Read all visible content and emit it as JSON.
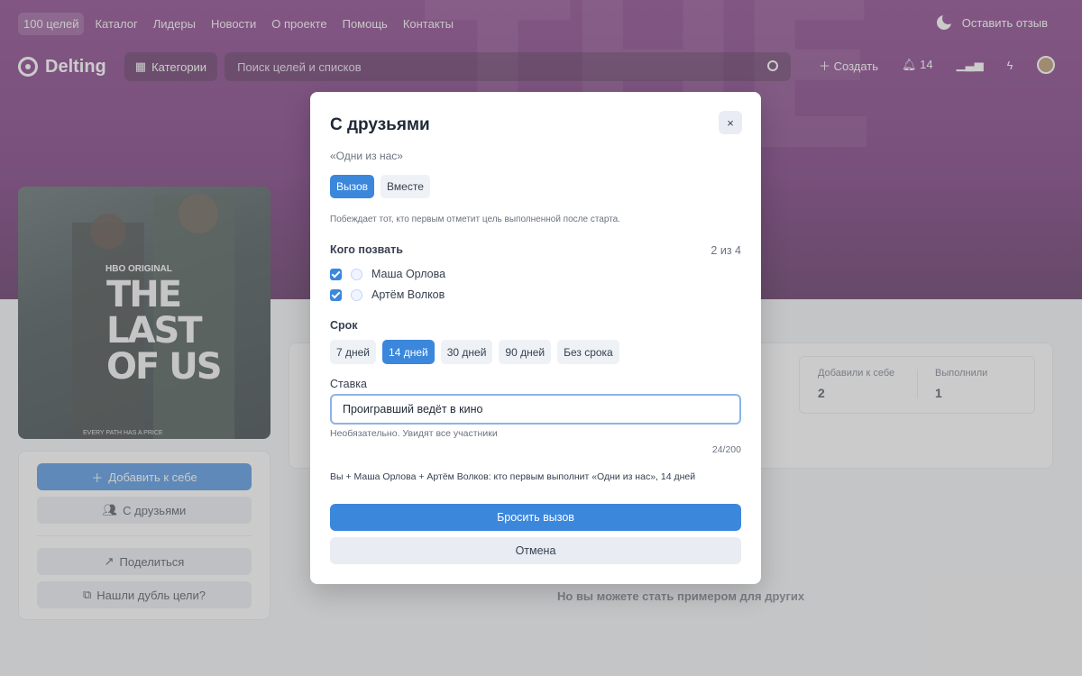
{
  "topnav": {
    "links": [
      "100 целей",
      "Каталог",
      "Лидеры",
      "Новости",
      "О проекте",
      "Помощь",
      "Контакты"
    ],
    "feedback_label": "Оставить отзыв"
  },
  "header": {
    "logo": "Delting",
    "categories_label": "Категории",
    "search_placeholder": "Поиск целей и списков",
    "create_label": "Создать",
    "notifications_count": "14"
  },
  "poster": {
    "network": "HBO ORIGINAL",
    "title_lines": [
      "THE",
      "LAST",
      "OF US"
    ],
    "tagline": "EVERY PATH HAS A PRICE"
  },
  "sidebar": {
    "add_label": "Добавить к себе",
    "friends_label": "С друзьями",
    "share_label": "Поделиться",
    "duplicate_label": "Нашли дубль цели?"
  },
  "stats": {
    "added_label": "Добавили к себе",
    "added_value": "2",
    "done_label": "Выполнили",
    "done_value": "1"
  },
  "empty_note": "Но вы можете стать примером для других",
  "modal": {
    "title": "С друзьями",
    "close_label": "×",
    "goal_name": "«Одни из нас»",
    "modes": [
      {
        "label": "Вызов",
        "active": true
      },
      {
        "label": "Вместе",
        "active": false
      }
    ],
    "mode_description": "Побеждает тот, кто первым отметит цель выполненной после старта.",
    "invite_label": "Кого позвать",
    "invite_count": "2 из 4",
    "friends": [
      {
        "name": "Маша Орлова",
        "checked": true
      },
      {
        "name": "Артём Волков",
        "checked": true
      }
    ],
    "duration_label": "Срок",
    "durations": [
      {
        "label": "7 дней",
        "active": false
      },
      {
        "label": "14 дней",
        "active": true
      },
      {
        "label": "30 дней",
        "active": false
      },
      {
        "label": "90 дней",
        "active": false
      },
      {
        "label": "Без срока",
        "active": false
      }
    ],
    "stake_label": "Ставка",
    "stake_value": "Проигравший ведёт в кино",
    "stake_helper": "Необязательно. Увидят все участники",
    "stake_counter": "24/200",
    "summary": "Вы + Маша Орлова + Артём Волков: кто первым выполнит «Одни из нас», 14 дней",
    "submit_label": "Бросить вызов",
    "cancel_label": "Отмена"
  },
  "colors": {
    "accent": "#3b87dc",
    "hero": "#7a2a7c"
  }
}
